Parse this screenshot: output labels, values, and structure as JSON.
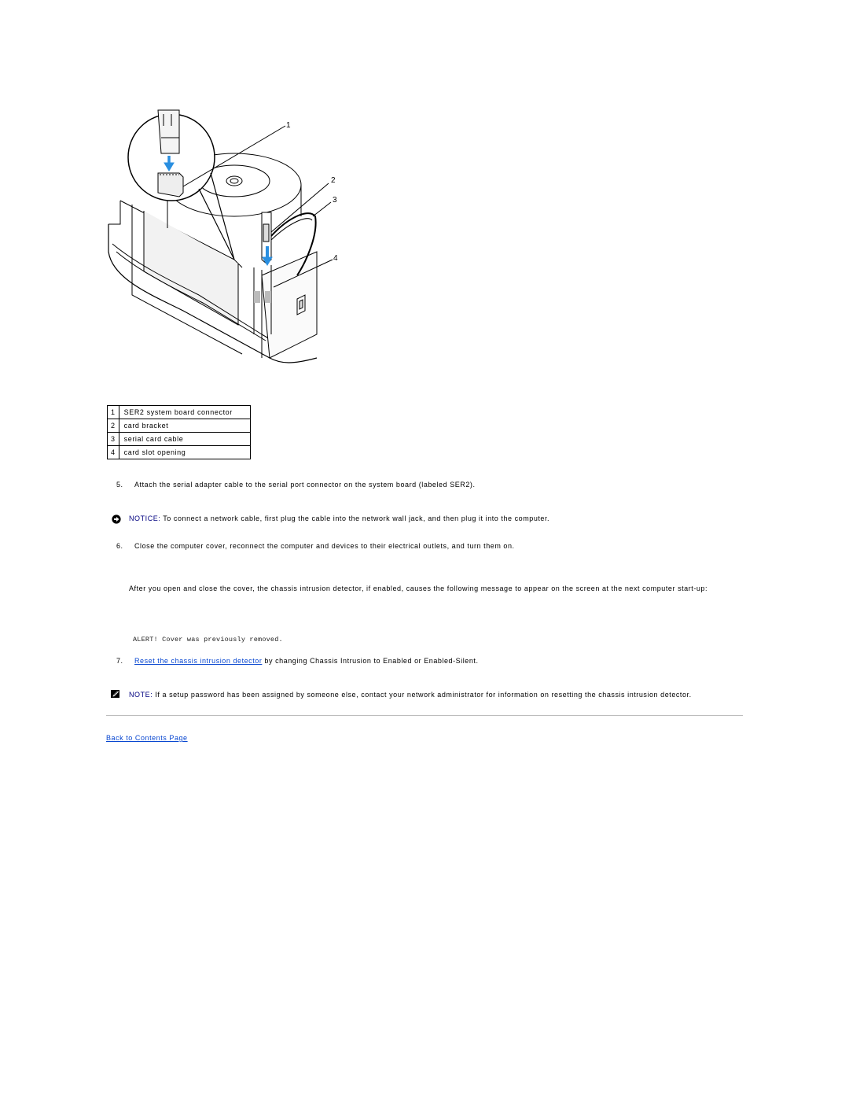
{
  "figure": {
    "name": "serial-card-cable-installation-illustration",
    "callout_markers": [
      "1",
      "2",
      "3",
      "4"
    ]
  },
  "callouts": [
    {
      "num": "1",
      "label": "SER2 system board connector"
    },
    {
      "num": "2",
      "label": "card bracket"
    },
    {
      "num": "3",
      "label": "serial card cable"
    },
    {
      "num": "4",
      "label": "card slot opening"
    }
  ],
  "steps": {
    "step5": {
      "num": "5.",
      "text": "Attach the serial adapter cable to the serial port connector on the system board (labeled SER2)."
    },
    "notice": {
      "icon": "notice-icon",
      "label": "NOTICE:",
      "text": " To connect a network cable, first plug the cable into the network wall jack, and then plug it into the computer."
    },
    "step6": {
      "num": "6.",
      "text": "Close the computer cover, reconnect the computer and devices to their electrical outlets, and turn them on."
    },
    "intrusion_paragraph": "After you open and close the cover, the chassis intrusion detector, if enabled, causes the following message to appear on the screen at the next computer start-up:",
    "alert_message": "ALERT! Cover was previously removed.",
    "step7": {
      "num": "7.",
      "link_text": "Reset the chassis intrusion detector",
      "text": " by changing Chassis Intrusion to Enabled or Enabled-Silent."
    },
    "note": {
      "icon": "note-pencil-icon",
      "label": "NOTE:",
      "text": " If a setup password has been assigned by someone else, contact your network administrator for information on resetting the chassis intrusion detector."
    }
  },
  "footer": {
    "back_link": "Back to Contents Page"
  },
  "colors": {
    "link": "#0645d0",
    "notice_label": "#000080",
    "rule": "#bdbdbd"
  }
}
